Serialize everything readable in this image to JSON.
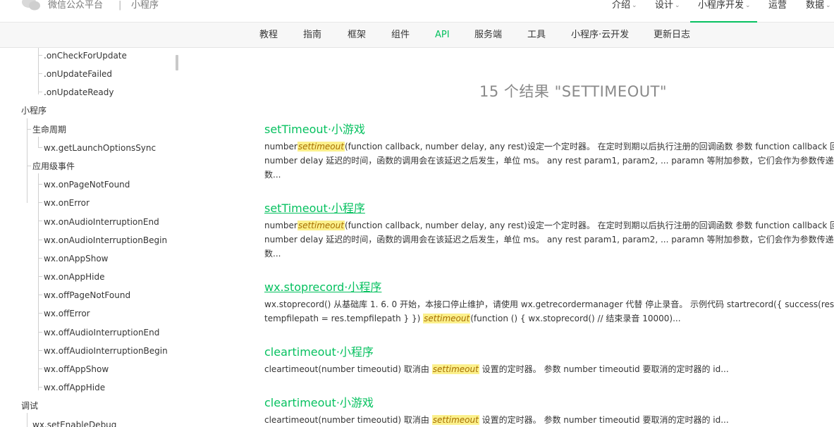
{
  "header": {
    "brand": "微信公众平台",
    "separator": "|",
    "brand_sub": "小程序",
    "nav": [
      {
        "label": "介绍",
        "chevron": "⌄"
      },
      {
        "label": "设计",
        "chevron": "⌄"
      },
      {
        "label": "小程序开发",
        "chevron": "⌄"
      },
      {
        "label": "运营",
        "chevron": ""
      },
      {
        "label": "数据",
        "chevron": "⌄"
      }
    ]
  },
  "subnav": [
    "教程",
    "指南",
    "框架",
    "组件",
    "API",
    "服务端",
    "工具",
    "小程序·云开发",
    "更新日志"
  ],
  "sidebar": [
    ".onCheckForUpdate",
    ".onUpdateFailed",
    ".onUpdateReady",
    "小程序",
    "生命周期",
    "wx.getLaunchOptionsSync",
    "应用级事件",
    "wx.onPageNotFound",
    "wx.onError",
    "wx.onAudioInterruptionEnd",
    "wx.onAudioInterruptionBegin",
    "wx.onAppShow",
    "wx.onAppHide",
    "wx.offPageNotFound",
    "wx.offError",
    "wx.offAudioInterruptionEnd",
    "wx.offAudioInterruptionBegin",
    "wx.offAppShow",
    "wx.offAppHide",
    "调试",
    "wx.setEnableDebug"
  ],
  "search": {
    "results_title": "15 个结果 \"SETTIMEOUT\"",
    "highlight": "settimeout",
    "results": [
      {
        "title": "setTimeout·小游戏",
        "line1_pre": "number",
        "line1_post": "(function callback, number delay, any rest)设定一个定时器。 在定时到期以后执行注册的回调函数 参数 function callback 回调",
        "line2": "number delay 延迟的时间，函数的调用会在该延迟之后发生，单位 ms。 any rest param1, param2, ... paramn 等附加参数，它们会作为参数传递给",
        "line3": "数..."
      },
      {
        "title": "setTimeout·小程序",
        "line1_pre": "number",
        "line1_post": "(function callback, number delay, any rest)设定一个定时器。 在定时到期以后执行注册的回调函数 参数 function callback 回调",
        "line2": "number delay 延迟的时间，函数的调用会在该延迟之后发生，单位 ms。 any rest param1, param2, ... paramn 等附加参数，它们会作为参数传递给",
        "line3": "数..."
      },
      {
        "title": "wx.stoprecord·小程序",
        "line1": "wx.stoprecord() 从基础库 1. 6. 0 开始，本接口停止维护，请使用 wx.getrecordermanager 代替 停止录音。 示例代码 startrecord({ success(res) {",
        "line2_pre": "tempfilepath = res.tempfilepath } }) ",
        "line2_post": "(function () { wx.stoprecord() // 结束录音 10000)..."
      },
      {
        "title": "cleartimeout·小程序",
        "line1_pre": "cleartimeout(number timeoutid) 取消由 ",
        "line1_post": " 设置的定时器。 参数 number timeoutid 要取消的定时器的 id..."
      },
      {
        "title": "cleartimeout·小游戏",
        "line1_pre": "cleartimeout(number timeoutid) 取消由 ",
        "line1_post": " 设置的定时器。 参数 number timeoutid 要取消的定时器的 id..."
      }
    ]
  },
  "colors": {
    "accent": "#07c160",
    "highlight_bg": "#fbf08c"
  }
}
